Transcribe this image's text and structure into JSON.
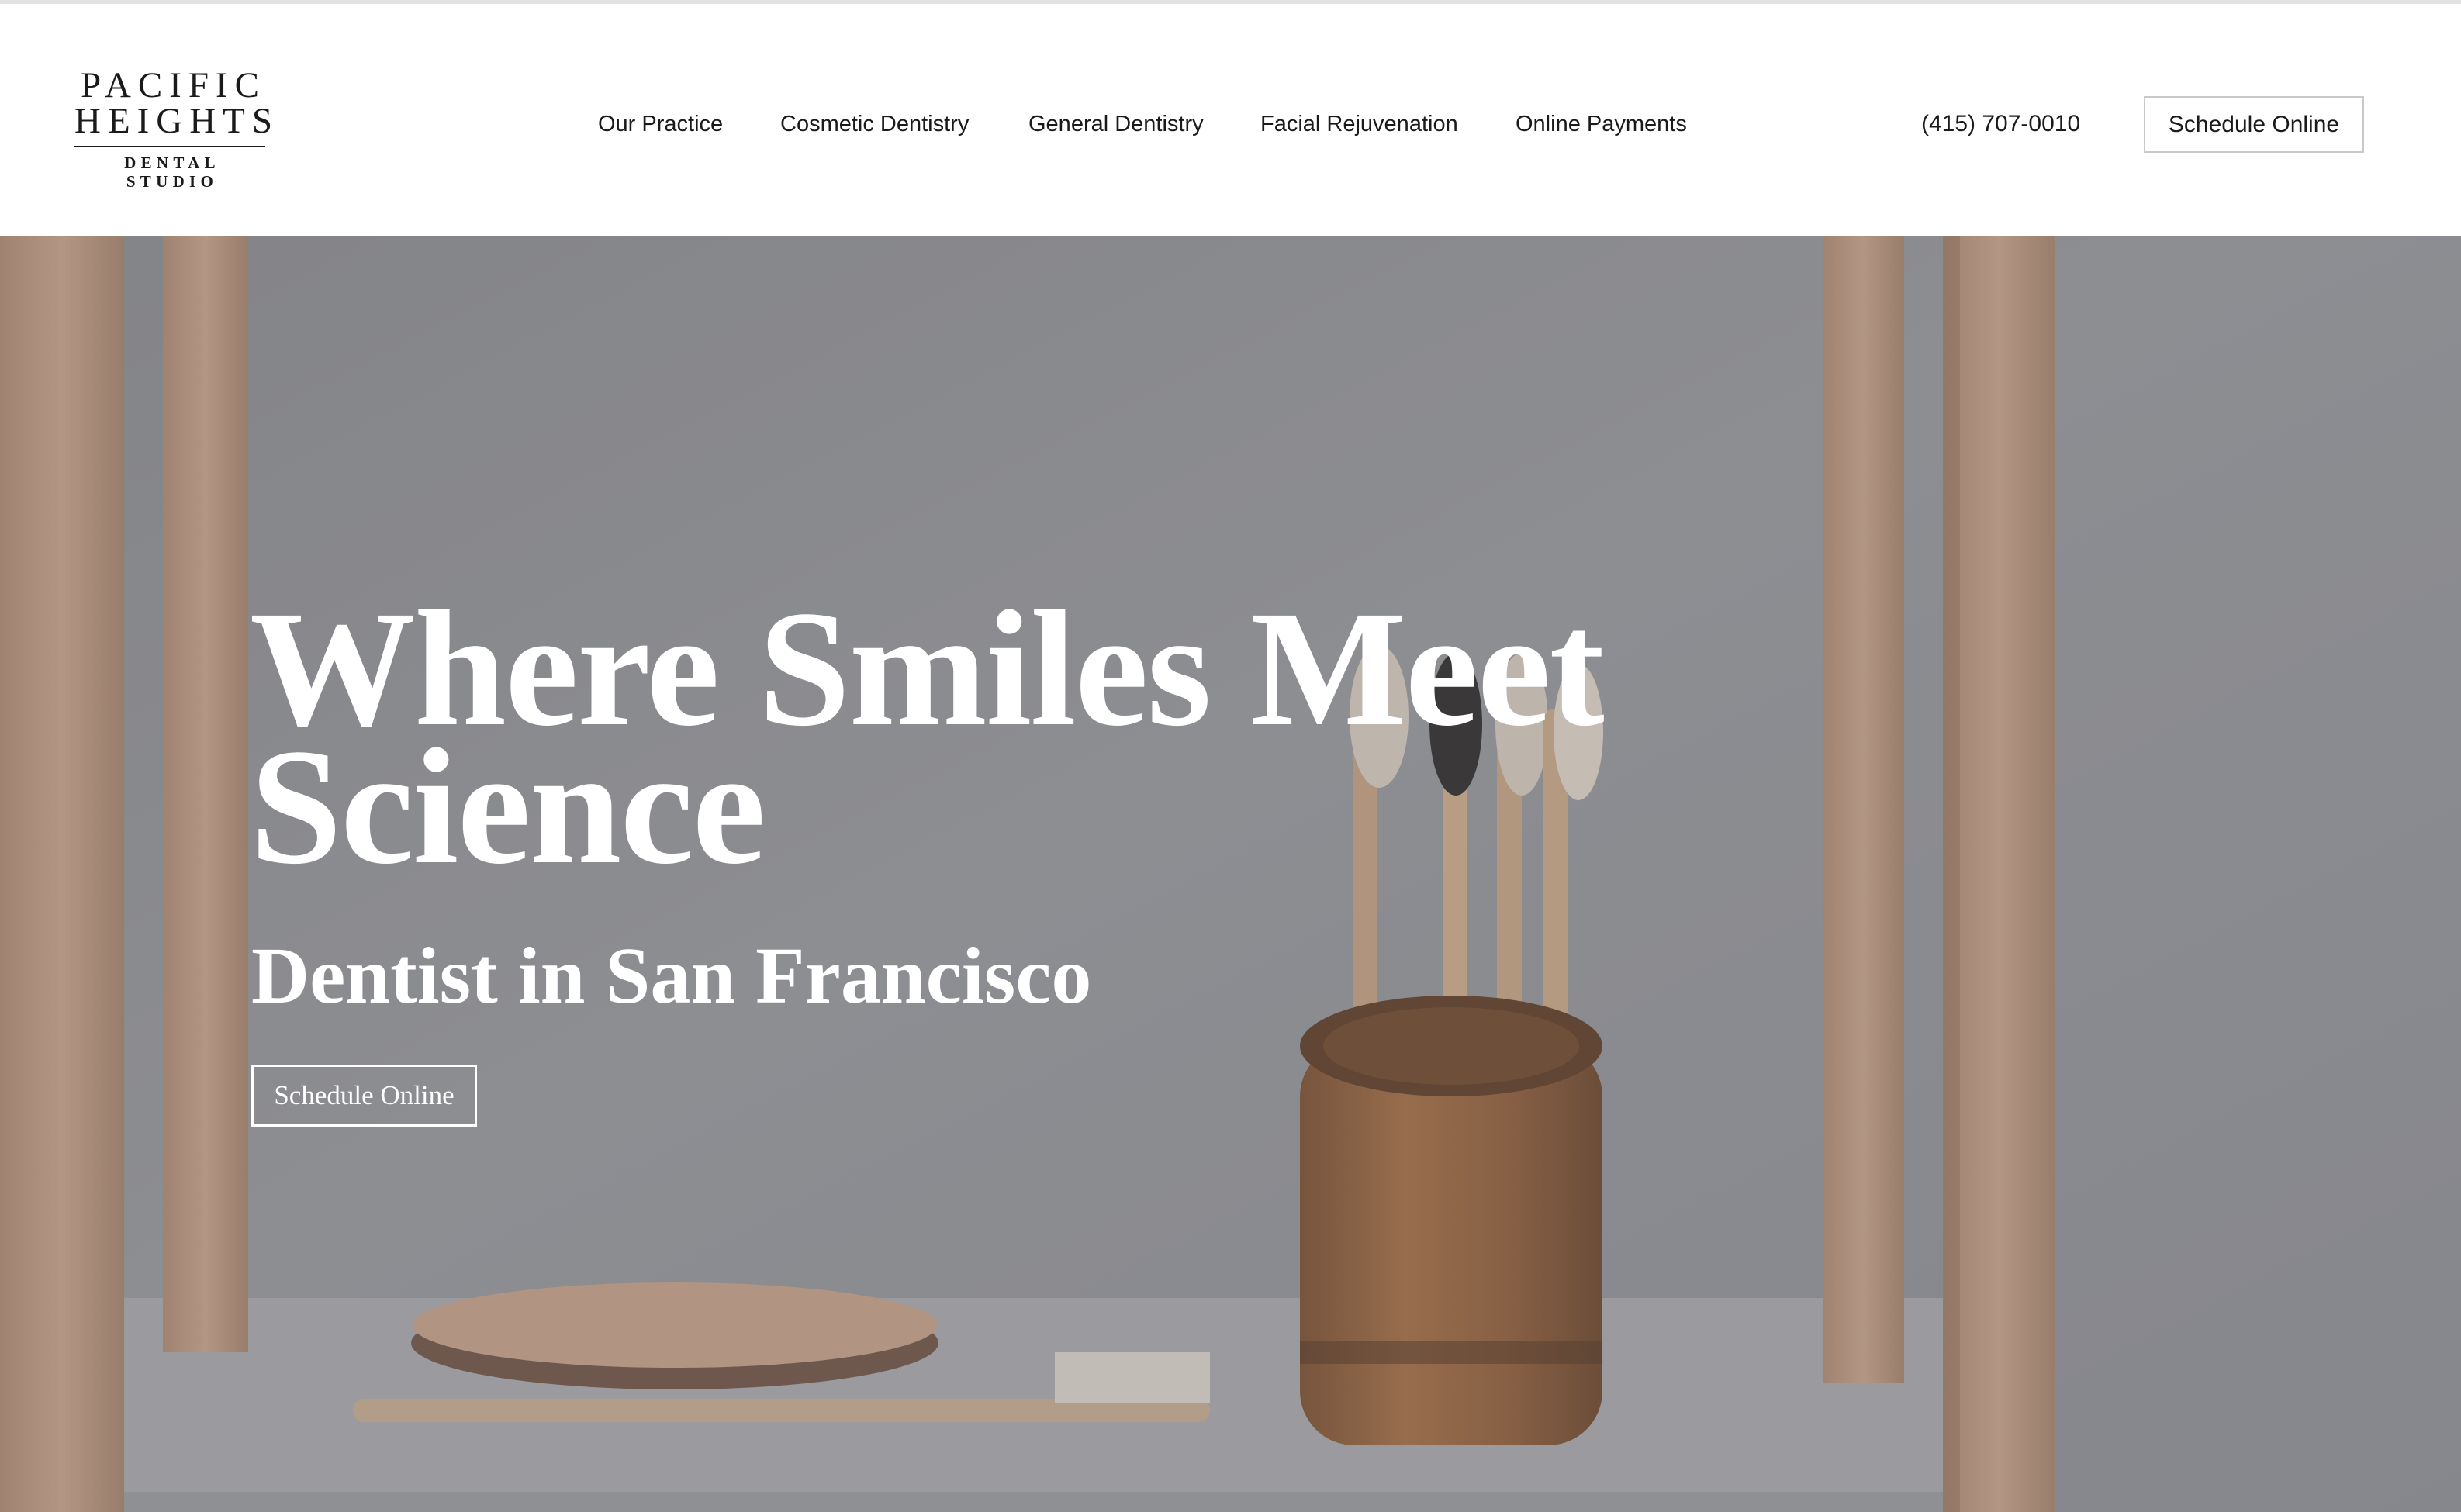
{
  "brand": {
    "line1": "PACIFIC",
    "line2": "HEIGHTS",
    "line3": "DENTAL STUDIO"
  },
  "nav": {
    "items": [
      {
        "label": "Our Practice"
      },
      {
        "label": "Cosmetic Dentistry"
      },
      {
        "label": "General Dentistry"
      },
      {
        "label": "Facial Rejuvenation"
      },
      {
        "label": "Online Payments"
      }
    ]
  },
  "header": {
    "phone": "(415) 707-0010",
    "cta_label": "Schedule Online"
  },
  "hero": {
    "title_line1": "Where Smiles Meet",
    "title_line2": "Science",
    "subtitle": "Dentist in San Francisco",
    "cta_label": "Schedule Online",
    "image_subject": "bamboo toothbrushes in a bamboo cup on a wooden shelf"
  },
  "colors": {
    "text": "#1a1a1a",
    "hero_overlay": "#7f8186",
    "hero_text": "#ffffff",
    "wood": "#d4b29a",
    "bamboo_cup": "#9a6438"
  }
}
